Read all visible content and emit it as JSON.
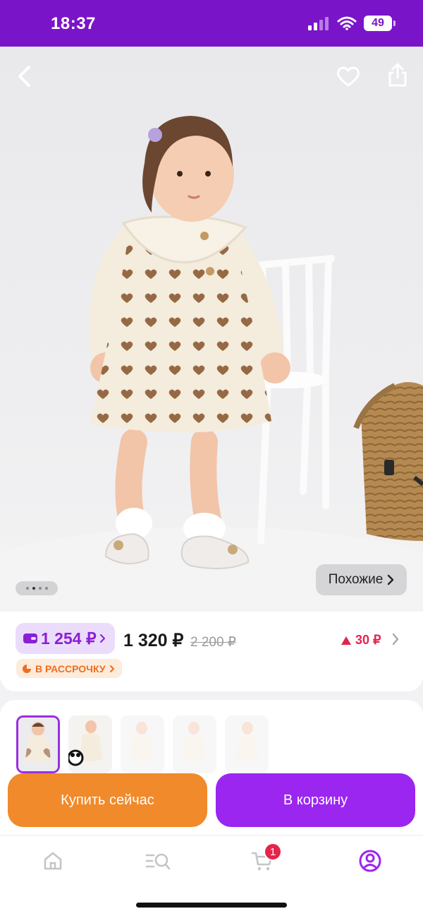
{
  "status_bar": {
    "time": "18:37",
    "battery": "49"
  },
  "product": {
    "similar_label": "Похожие",
    "gallery_pages": 4,
    "gallery_active_page": 1
  },
  "price": {
    "wallet_price": "1 254 ₽",
    "current_price": "1 320 ₽",
    "old_price": "2 200 ₽",
    "rise_amount": "30 ₽",
    "installment_label": "В РАССРОЧКУ"
  },
  "thumbnails": {
    "count": 5,
    "active_index": 0
  },
  "actions": {
    "buy_now": "Купить сейчас",
    "add_to_cart": "В корзину"
  },
  "tabbar": {
    "cart_count": "1"
  },
  "colors": {
    "brand": "#7a14c9",
    "accent_purple": "#9b26f0",
    "accent_orange": "#f08a2a",
    "badge_red": "#e6244a"
  },
  "icons": [
    "back-icon",
    "heart-icon",
    "share-icon",
    "wallet-icon",
    "installment-icon",
    "home-icon",
    "catalog-search-icon",
    "cart-icon",
    "profile-icon"
  ]
}
